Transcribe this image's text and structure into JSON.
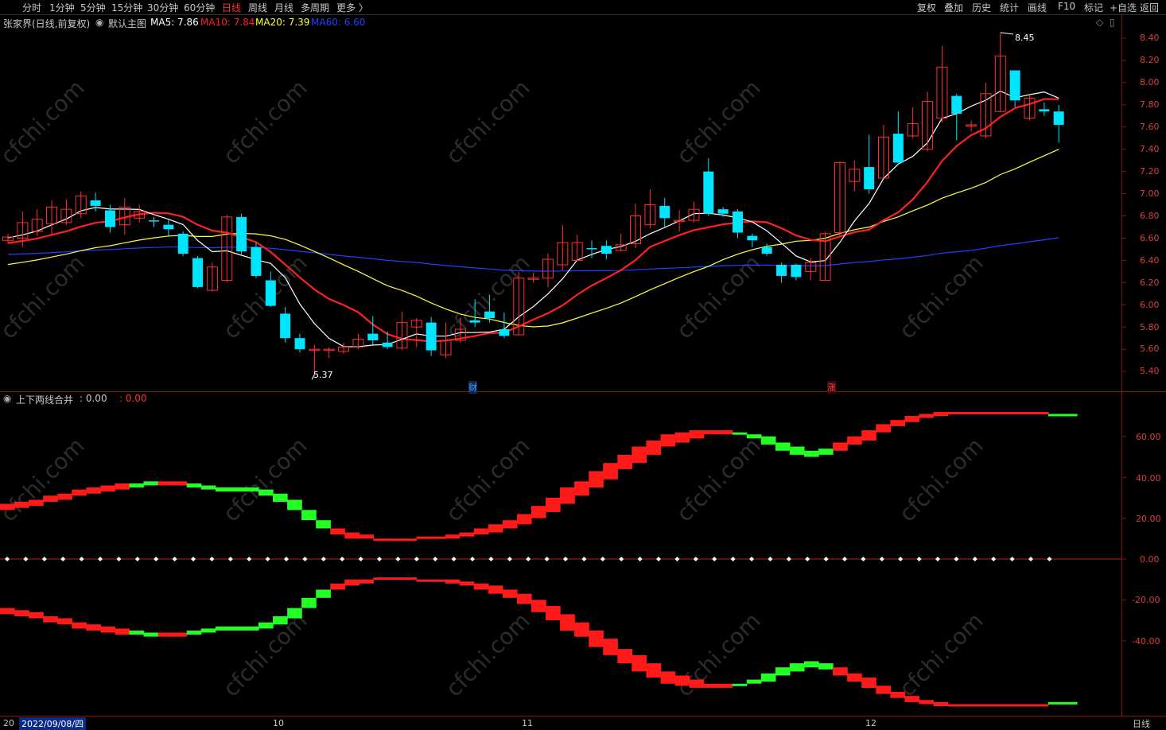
{
  "toolbar": {
    "periods": [
      "分时",
      "1分钟",
      "5分钟",
      "15分钟",
      "30分钟",
      "60分钟",
      "日线",
      "周线",
      "月线",
      "多周期",
      "更多 〉"
    ],
    "active_period": "日线",
    "right": [
      "复权",
      "叠加",
      "历史",
      "统计",
      "画线",
      "F10",
      "标记",
      "+自选",
      "返回"
    ]
  },
  "main_chart": {
    "stock": "张家界(日线,前复权)",
    "template": "默认主图",
    "ma_labels": [
      {
        "label": "MA5: 7.86",
        "color": "#ffffff"
      },
      {
        "label": "MA10: 7.84",
        "color": "#ff2020"
      },
      {
        "label": "MA20: 7.39",
        "color": "#ffff40"
      },
      {
        "label": "MA60: 6.60",
        "color": "#2040ff"
      }
    ],
    "ylim": [
      5.3,
      8.5
    ],
    "yticks": [
      "8.40",
      "8.20",
      "8.00",
      "7.80",
      "7.60",
      "7.40",
      "7.20",
      "7.00",
      "6.80",
      "6.60",
      "6.40",
      "6.20",
      "6.00",
      "5.80",
      "5.60",
      "5.40"
    ],
    "high_label": "8.45",
    "low_label": "5.37",
    "markers": [
      {
        "text": "财",
        "color": "#40a0ff"
      },
      {
        "text": "涨",
        "color": "#ff4040"
      }
    ],
    "candles": [
      [
        6.58,
        6.61,
        6.64,
        6.55
      ],
      [
        6.6,
        6.74,
        6.84,
        6.52
      ],
      [
        6.66,
        6.77,
        6.86,
        6.62
      ],
      [
        6.73,
        6.88,
        6.94,
        6.62
      ],
      [
        6.74,
        6.86,
        6.95,
        6.72
      ],
      [
        6.82,
        6.98,
        7.02,
        6.78
      ],
      [
        6.94,
        6.89,
        7.01,
        6.84
      ],
      [
        6.85,
        6.7,
        6.9,
        6.65
      ],
      [
        6.72,
        6.88,
        6.96,
        6.63
      ],
      [
        6.78,
        6.84,
        6.9,
        6.74
      ],
      [
        6.76,
        6.75,
        6.79,
        6.7
      ],
      [
        6.72,
        6.68,
        6.77,
        6.62
      ],
      [
        6.64,
        6.46,
        6.66,
        6.44
      ],
      [
        6.42,
        6.16,
        6.44,
        6.15
      ],
      [
        6.13,
        6.34,
        6.38,
        6.12
      ],
      [
        6.22,
        6.79,
        6.81,
        6.2
      ],
      [
        6.79,
        6.48,
        6.82,
        6.44
      ],
      [
        6.52,
        6.26,
        6.56,
        6.24
      ],
      [
        6.22,
        5.99,
        6.3,
        5.98
      ],
      [
        5.92,
        5.7,
        5.98,
        5.66
      ],
      [
        5.7,
        5.6,
        5.74,
        5.57
      ],
      [
        5.6,
        5.6,
        5.64,
        5.37
      ],
      [
        5.6,
        5.6,
        5.62,
        5.52
      ],
      [
        5.58,
        5.62,
        5.66,
        5.56
      ],
      [
        5.62,
        5.69,
        5.74,
        5.6
      ],
      [
        5.74,
        5.68,
        5.9,
        5.64
      ],
      [
        5.66,
        5.62,
        5.76,
        5.6
      ],
      [
        5.61,
        5.84,
        5.94,
        5.59
      ],
      [
        5.8,
        5.86,
        5.88,
        5.62
      ],
      [
        5.84,
        5.59,
        5.89,
        5.54
      ],
      [
        5.55,
        5.68,
        5.84,
        5.52
      ],
      [
        5.68,
        5.78,
        5.88,
        5.66
      ],
      [
        5.86,
        5.84,
        6.05,
        5.8
      ],
      [
        5.94,
        5.88,
        6.09,
        5.84
      ],
      [
        5.78,
        5.72,
        5.93,
        5.7
      ],
      [
        5.73,
        6.24,
        6.3,
        5.73
      ],
      [
        6.24,
        6.24,
        6.29,
        6.2
      ],
      [
        6.24,
        6.41,
        6.46,
        6.16
      ],
      [
        6.36,
        6.56,
        6.72,
        6.31
      ],
      [
        6.4,
        6.56,
        6.63,
        6.4
      ],
      [
        6.51,
        6.5,
        6.58,
        6.42
      ],
      [
        6.53,
        6.46,
        6.58,
        6.41
      ],
      [
        6.49,
        6.54,
        6.64,
        6.48
      ],
      [
        6.55,
        6.8,
        6.91,
        6.51
      ],
      [
        6.72,
        6.9,
        7.04,
        6.69
      ],
      [
        6.89,
        6.78,
        6.96,
        6.7
      ],
      [
        6.76,
        6.76,
        6.85,
        6.66
      ],
      [
        6.76,
        6.86,
        6.93,
        6.74
      ],
      [
        7.2,
        6.82,
        7.32,
        6.8
      ],
      [
        6.86,
        6.82,
        6.88,
        6.79
      ],
      [
        6.84,
        6.65,
        6.86,
        6.6
      ],
      [
        6.62,
        6.58,
        6.64,
        6.52
      ],
      [
        6.52,
        6.46,
        6.55,
        6.44
      ],
      [
        6.36,
        6.26,
        6.38,
        6.2
      ],
      [
        6.36,
        6.25,
        6.37,
        6.22
      ],
      [
        6.3,
        6.38,
        6.42,
        6.22
      ],
      [
        6.22,
        6.64,
        6.66,
        6.22
      ],
      [
        6.65,
        7.28,
        7.29,
        6.62
      ],
      [
        7.11,
        7.22,
        7.3,
        7.02
      ],
      [
        7.24,
        7.04,
        7.53,
        7.0
      ],
      [
        7.14,
        7.51,
        7.62,
        7.14
      ],
      [
        7.54,
        7.28,
        7.74,
        7.26
      ],
      [
        7.52,
        7.63,
        7.78,
        7.5
      ],
      [
        7.4,
        7.83,
        7.92,
        7.38
      ],
      [
        7.68,
        8.14,
        8.33,
        7.64
      ],
      [
        7.88,
        7.72,
        7.9,
        7.48
      ],
      [
        7.62,
        7.62,
        7.66,
        7.56
      ],
      [
        7.52,
        7.9,
        8.0,
        7.5
      ],
      [
        7.74,
        8.24,
        8.45,
        7.74
      ],
      [
        8.11,
        7.84,
        8.11,
        7.78
      ],
      [
        7.68,
        7.86,
        7.9,
        7.66
      ],
      [
        7.76,
        7.74,
        7.82,
        7.7
      ],
      [
        7.74,
        7.62,
        7.8,
        7.46
      ]
    ]
  },
  "indicator": {
    "title": "上下两线合并",
    "v1": ": 0.00",
    "v2": ": 0.00",
    "ylim": [
      -60,
      70
    ],
    "yticks": [
      "60.00",
      "40.00",
      "20.00",
      "0.00",
      "-20.00",
      "-40.00"
    ],
    "upper_band": [
      [
        24,
        27
      ],
      [
        25,
        28
      ],
      [
        26,
        29
      ],
      [
        28,
        31
      ],
      [
        29,
        32
      ],
      [
        31,
        34
      ],
      [
        32,
        35
      ],
      [
        33,
        36
      ],
      [
        34,
        37
      ],
      [
        35,
        37
      ],
      [
        36,
        38
      ],
      [
        36,
        38
      ],
      [
        36,
        38
      ],
      [
        35,
        37
      ],
      [
        34,
        36
      ],
      [
        33,
        35
      ],
      [
        33,
        35
      ],
      [
        33,
        35
      ],
      [
        31,
        34
      ],
      [
        28,
        32
      ],
      [
        24,
        29
      ],
      [
        19,
        24
      ],
      [
        15,
        19
      ],
      [
        12,
        15
      ],
      [
        10,
        13
      ],
      [
        10,
        12
      ],
      [
        9,
        10
      ],
      [
        9,
        10
      ],
      [
        9,
        10
      ],
      [
        10,
        11
      ],
      [
        10,
        11
      ],
      [
        10,
        12
      ],
      [
        11,
        13
      ],
      [
        12,
        15
      ],
      [
        13,
        17
      ],
      [
        15,
        19
      ],
      [
        17,
        22
      ],
      [
        20,
        26
      ],
      [
        23,
        30
      ],
      [
        27,
        35
      ],
      [
        31,
        38
      ],
      [
        35,
        43
      ],
      [
        39,
        47
      ],
      [
        44,
        51
      ],
      [
        47,
        55
      ],
      [
        51,
        58
      ],
      [
        55,
        61
      ],
      [
        57,
        62
      ],
      [
        59,
        63
      ],
      [
        61,
        63
      ],
      [
        61,
        63
      ],
      [
        61,
        62
      ],
      [
        59,
        61
      ],
      [
        56,
        60
      ],
      [
        53,
        57
      ],
      [
        51,
        55
      ],
      [
        50,
        53
      ],
      [
        51,
        54
      ],
      [
        53,
        57
      ],
      [
        56,
        60
      ],
      [
        58,
        63
      ],
      [
        62,
        66
      ],
      [
        65,
        68
      ],
      [
        67,
        70
      ],
      [
        69,
        71
      ],
      [
        70,
        72
      ],
      [
        71,
        72
      ],
      [
        71,
        72
      ],
      [
        71,
        72
      ],
      [
        71,
        72
      ],
      [
        71,
        72
      ],
      [
        71,
        72
      ],
      [
        71,
        72
      ],
      [
        70,
        71
      ],
      [
        70,
        71
      ]
    ],
    "upper_colors": "RRRRRRRRRGGRRGGGGGGGGGGRRRRRRRRRRRRRRRRRRRRRRRRRRRRGGGGGGGRRRRRRRRRRRRRRRGGGG",
    "lower_band": [
      [
        -24,
        -27
      ],
      [
        -25,
        -28
      ],
      [
        -26,
        -29
      ],
      [
        -28,
        -31
      ],
      [
        -29,
        -32
      ],
      [
        -31,
        -34
      ],
      [
        -32,
        -35
      ],
      [
        -33,
        -36
      ],
      [
        -34,
        -37
      ],
      [
        -35,
        -37
      ],
      [
        -36,
        -38
      ],
      [
        -36,
        -38
      ],
      [
        -36,
        -38
      ],
      [
        -35,
        -37
      ],
      [
        -34,
        -36
      ],
      [
        -33,
        -35
      ],
      [
        -33,
        -35
      ],
      [
        -33,
        -35
      ],
      [
        -31,
        -34
      ],
      [
        -28,
        -32
      ],
      [
        -24,
        -29
      ],
      [
        -19,
        -24
      ],
      [
        -15,
        -19
      ],
      [
        -12,
        -15
      ],
      [
        -10,
        -13
      ],
      [
        -10,
        -12
      ],
      [
        -9,
        -10
      ],
      [
        -9,
        -10
      ],
      [
        -9,
        -10
      ],
      [
        -10,
        -11
      ],
      [
        -10,
        -11
      ],
      [
        -10,
        -12
      ],
      [
        -11,
        -13
      ],
      [
        -12,
        -15
      ],
      [
        -13,
        -17
      ],
      [
        -15,
        -19
      ],
      [
        -17,
        -22
      ],
      [
        -20,
        -26
      ],
      [
        -23,
        -30
      ],
      [
        -27,
        -35
      ],
      [
        -31,
        -38
      ],
      [
        -35,
        -43
      ],
      [
        -39,
        -47
      ],
      [
        -44,
        -51
      ],
      [
        -47,
        -55
      ],
      [
        -51,
        -58
      ],
      [
        -55,
        -61
      ],
      [
        -57,
        -62
      ],
      [
        -59,
        -63
      ],
      [
        -61,
        -63
      ],
      [
        -61,
        -63
      ],
      [
        -61,
        -62
      ],
      [
        -59,
        -61
      ],
      [
        -56,
        -60
      ],
      [
        -53,
        -57
      ],
      [
        -51,
        -55
      ],
      [
        -50,
        -53
      ],
      [
        -51,
        -54
      ],
      [
        -53,
        -57
      ],
      [
        -56,
        -60
      ],
      [
        -58,
        -63
      ],
      [
        -62,
        -66
      ],
      [
        -65,
        -68
      ],
      [
        -67,
        -70
      ],
      [
        -69,
        -71
      ],
      [
        -70,
        -72
      ],
      [
        -71,
        -72
      ],
      [
        -71,
        -72
      ],
      [
        -71,
        -72
      ],
      [
        -71,
        -72
      ],
      [
        -71,
        -72
      ],
      [
        -71,
        -72
      ],
      [
        -71,
        -72
      ],
      [
        -70,
        -71
      ],
      [
        -70,
        -71
      ]
    ],
    "lower_colors": "RRRRRRRRRGGRRGGGGGGGGGGRRRRRRRRRRRRRRRRRRRRRRRRRRRRGGGGGGGRRRRRRRRRRRRRRRGGGG"
  },
  "bottom_axis": {
    "cursor_date": "2022/09/08/四",
    "cursor_prefix": "20",
    "months": [
      "10",
      "11",
      "12"
    ],
    "period_label": "日线"
  },
  "watermark": "cfchi.com",
  "colors": {
    "up": "#ff3030",
    "down": "#00e5ff",
    "ma5": "#ffffff",
    "ma10": "#ff2020",
    "ma20": "#ffff40",
    "ma60": "#2040ff",
    "axis": "#8a1010",
    "green": "#22ff22",
    "red": "#ff1a1a"
  }
}
